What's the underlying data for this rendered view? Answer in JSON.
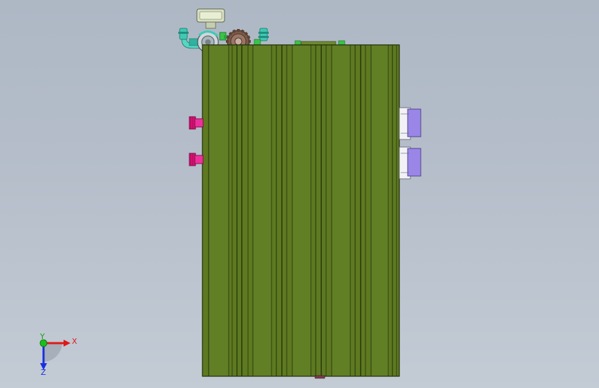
{
  "triad": {
    "x_label": "X",
    "y_label": "Y",
    "z_label": "Z"
  },
  "colors": {
    "background_top": "#aeb8c5",
    "background_bottom": "#c3cbd5",
    "housing_green": "#5e7a21",
    "housing_green_dark": "#3f5515",
    "fitting_cyan": "#3fc9b4",
    "fitting_magenta": "#e0107a",
    "connector_purple": "#9a86e6",
    "gear_brown": "#7b5a4a",
    "axis_x": "#e01818",
    "axis_y": "#18c018",
    "axis_z": "#1830e0"
  },
  "icons": {
    "gauge": "pressure-gauge-icon",
    "gear": "gear-icon",
    "triad": "axis-triad-icon"
  }
}
